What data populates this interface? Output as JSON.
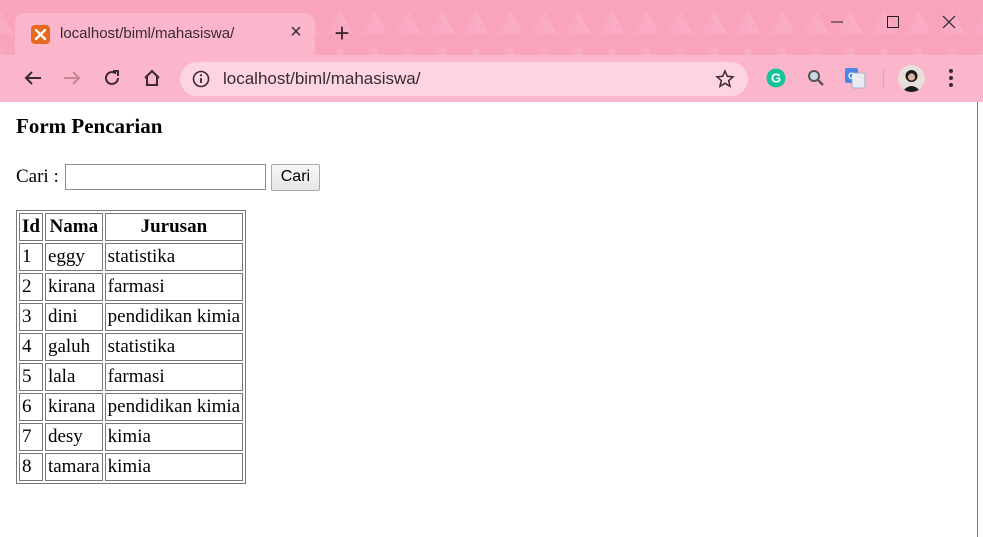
{
  "browser": {
    "tab_title": "localhost/biml/mahasiswa/",
    "url": "localhost/biml/mahasiswa/",
    "theme_color": "#f9a3bd",
    "favicon_color": "#e8681f"
  },
  "page": {
    "title": "Form Pencarian",
    "search_label": "Cari :",
    "search_value": "",
    "search_button": "Cari",
    "table": {
      "headers": [
        "Id",
        "Nama",
        "Jurusan"
      ],
      "rows": [
        [
          "1",
          "eggy",
          "statistika"
        ],
        [
          "2",
          "kirana",
          "farmasi"
        ],
        [
          "3",
          "dini",
          "pendidikan kimia"
        ],
        [
          "4",
          "galuh",
          "statistika"
        ],
        [
          "5",
          "lala",
          "farmasi"
        ],
        [
          "6",
          "kirana",
          "pendidikan kimia"
        ],
        [
          "7",
          "desy",
          "kimia"
        ],
        [
          "8",
          "tamara",
          "kimia"
        ]
      ]
    }
  }
}
